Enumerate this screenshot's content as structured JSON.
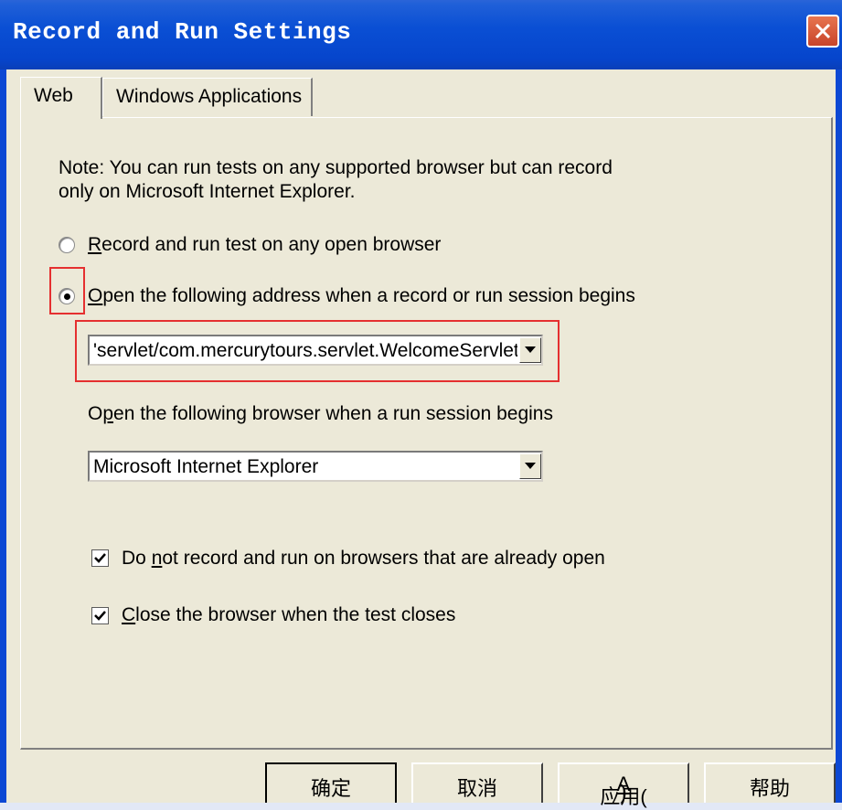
{
  "window": {
    "title": "Record and Run Settings"
  },
  "tabs": [
    {
      "label": "Web"
    },
    {
      "label": "Windows Applications"
    }
  ],
  "note": {
    "line1": "Note: You can run tests on any supported browser but can record",
    "line2": "only on Microsoft Internet Explorer."
  },
  "options": {
    "radio_any_browser": {
      "label": "Record and run test on any open browser",
      "accel": "R",
      "rest": "ecord and run test on any open browser",
      "selected": false
    },
    "radio_open_address": {
      "label": "Open the following address when a record or run session begins",
      "accel": "O",
      "rest": "pen the following address when a record or run session begins",
      "selected": true
    }
  },
  "address_combo": {
    "value": "'servlet/com.mercurytours.servlet.WelcomeServlet"
  },
  "browser_label": {
    "pre": "O",
    "accel": "p",
    "rest": "en the following browser when a run session begins"
  },
  "browser_combo": {
    "value": "Microsoft Internet Explorer"
  },
  "checkboxes": {
    "no_open_browsers": {
      "pre": "Do ",
      "accel": "n",
      "rest": "ot record and run on browsers that are already open",
      "checked": true
    },
    "close_browser": {
      "pre": "",
      "accel": "C",
      "rest": "lose the browser when the test closes",
      "checked": true
    }
  },
  "buttons": {
    "ok": "确定",
    "cancel": "取消",
    "apply_pre": "应用(",
    "apply_accel": "A",
    "apply_post": ")",
    "help": "帮助"
  },
  "colors": {
    "title_bar": "#0a4fd4",
    "dialog_bg": "#ece9d8",
    "highlight_box": "#e53030"
  }
}
